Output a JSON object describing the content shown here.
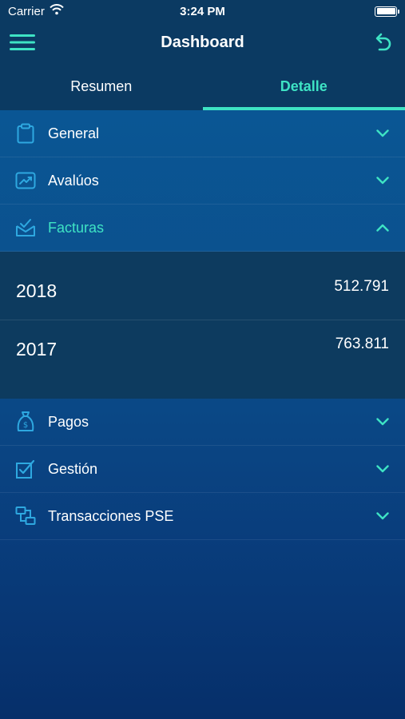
{
  "status_bar": {
    "carrier": "Carrier",
    "time": "3:24 PM"
  },
  "nav": {
    "title": "Dashboard",
    "menu_icon": "hamburger-icon",
    "action_icon": "undo-icon"
  },
  "tabs": [
    {
      "label": "Resumen",
      "active": false
    },
    {
      "label": "Detalle",
      "active": true
    }
  ],
  "sections_top": [
    {
      "label": "General",
      "icon": "clipboard-icon",
      "expanded": false
    },
    {
      "label": "Avalúos",
      "icon": "trend-chart-icon",
      "expanded": false
    },
    {
      "label": "Facturas",
      "icon": "mail-check-icon",
      "expanded": true
    }
  ],
  "facturas_rows": [
    {
      "year": "2018",
      "value": "512.791"
    },
    {
      "year": "2017",
      "value": "763.811"
    }
  ],
  "sections_bottom": [
    {
      "label": "Pagos",
      "icon": "money-bag-icon",
      "expanded": false
    },
    {
      "label": "Gestión",
      "icon": "checkbox-icon",
      "expanded": false
    },
    {
      "label": "Transacciones PSE",
      "icon": "transfer-icon",
      "expanded": false
    }
  ],
  "colors": {
    "accent": "#3ee3c4",
    "icon_blue": "#2ea8e0",
    "header_bg": "#0b3a62"
  }
}
